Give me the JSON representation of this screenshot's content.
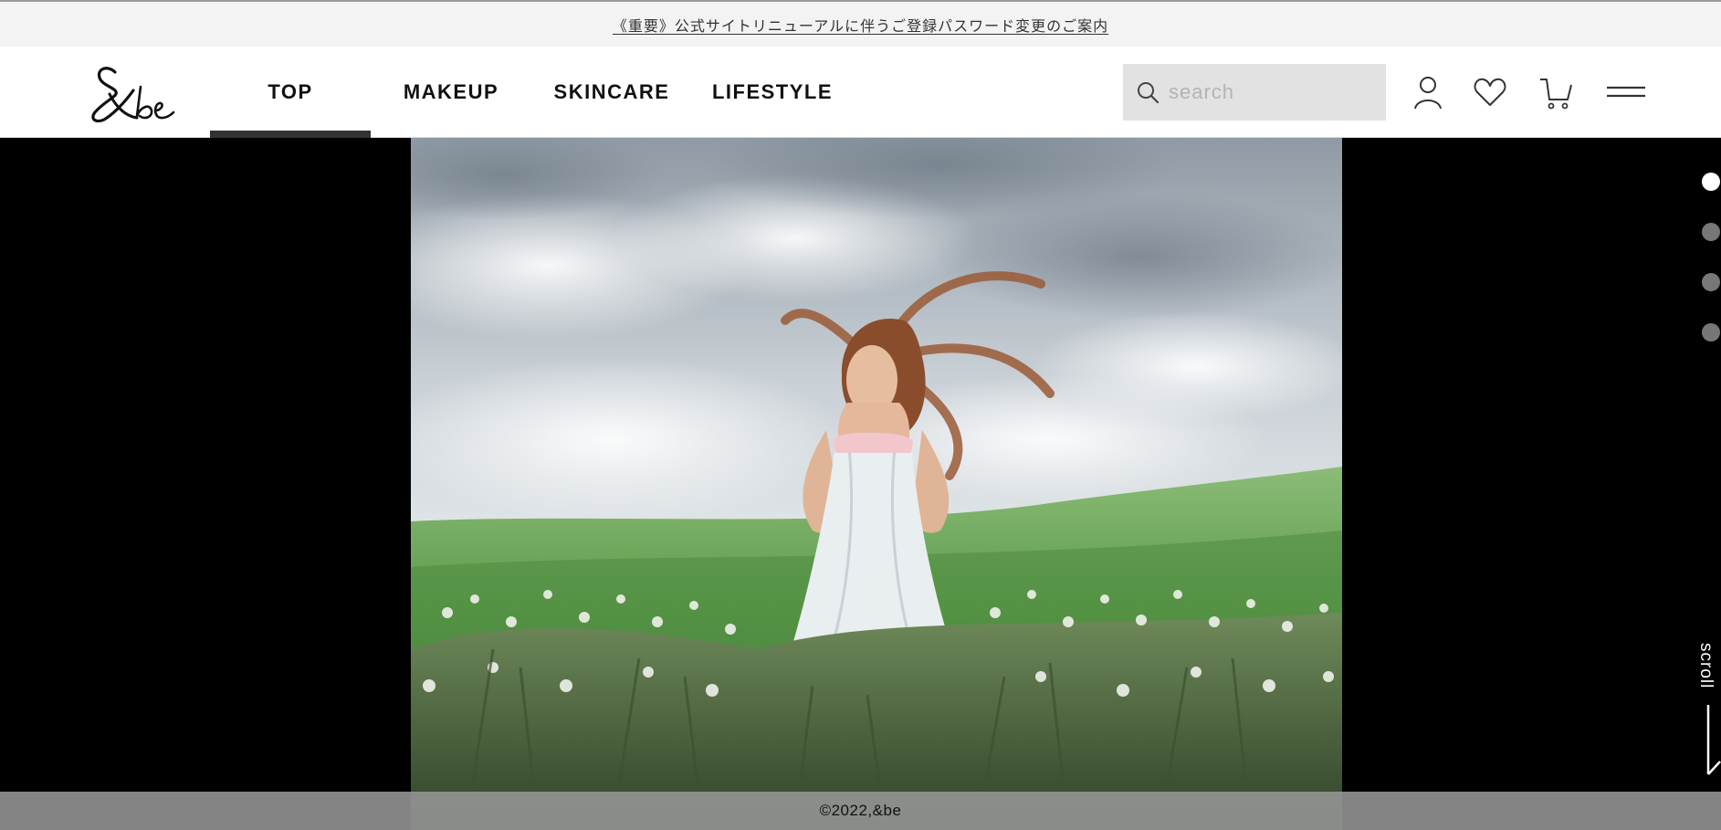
{
  "announcement": {
    "text": "《重要》公式サイトリニューアルに伴うご登録パスワード変更のご案内"
  },
  "header": {
    "logo_text": "&be",
    "nav": [
      {
        "label": "TOP",
        "active": true
      },
      {
        "label": "MAKEUP",
        "active": false
      },
      {
        "label": "SKINCARE",
        "active": false
      },
      {
        "label": "LIFESTYLE",
        "active": false
      }
    ],
    "search": {
      "placeholder": "search",
      "value": ""
    },
    "icons": [
      "search-icon",
      "user-icon",
      "heart-icon",
      "cart-icon",
      "menu-icon"
    ]
  },
  "hero": {
    "image": "woman-in-white-dress-in-meadow-photo",
    "slides_total": 4,
    "active_slide": 1,
    "scroll_label": "scroll"
  },
  "footer": {
    "copyright": "©2022,&be"
  },
  "colors": {
    "accent": "#333333",
    "announce_bg": "#f3f3f3",
    "search_bg": "#e2e2e2"
  }
}
